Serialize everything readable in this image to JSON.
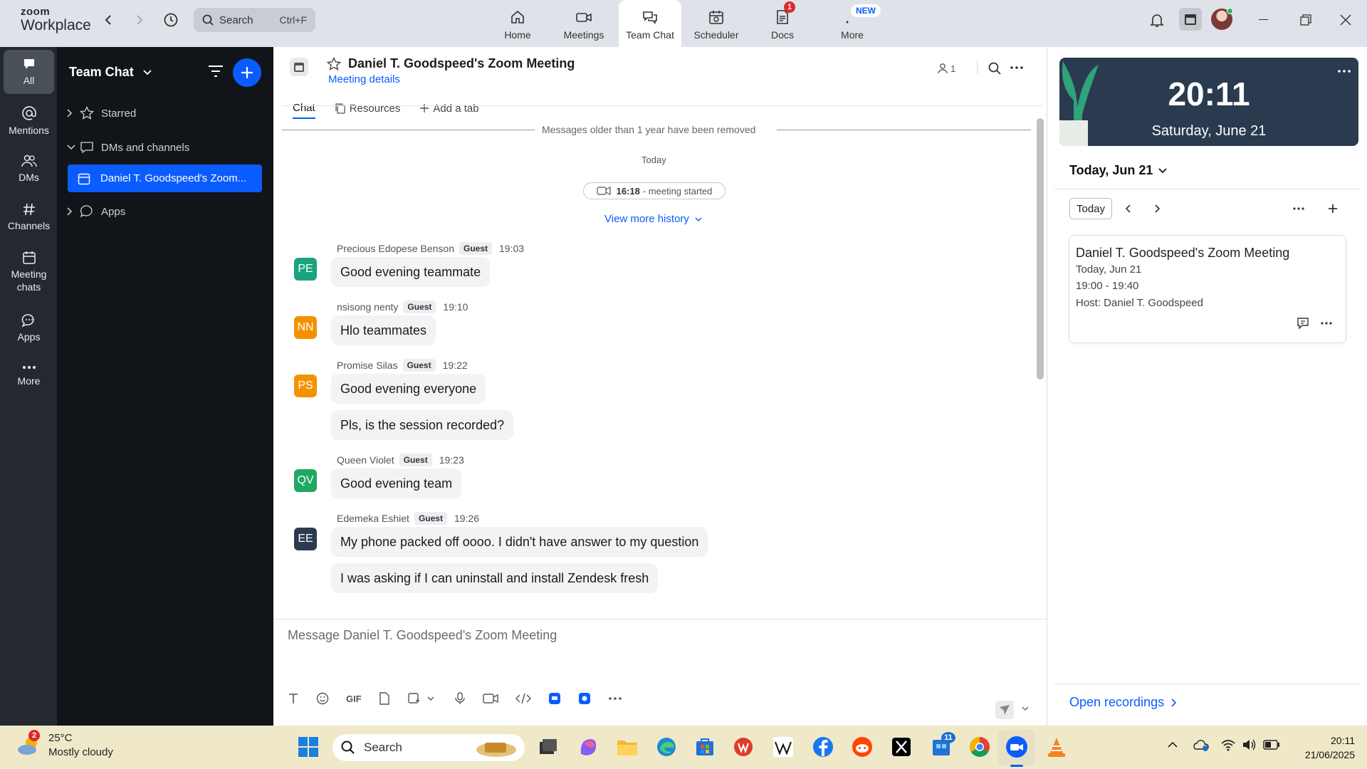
{
  "topbar": {
    "brand_line1": "zoom",
    "brand_line2": "Workplace",
    "search_placeholder": "Search",
    "search_shortcut": "Ctrl+F",
    "nav": [
      {
        "label": "Home",
        "icon": "home-icon"
      },
      {
        "label": "Meetings",
        "icon": "video-camera-icon"
      },
      {
        "label": "Team Chat",
        "icon": "chat-bubbles-icon",
        "active": true
      },
      {
        "label": "Scheduler",
        "icon": "calendar-clock-icon"
      },
      {
        "label": "Docs",
        "icon": "document-icon",
        "badge": "1"
      },
      {
        "label": "More",
        "icon": "more-dots-icon",
        "badge": "NEW"
      }
    ]
  },
  "rail": {
    "items": [
      {
        "label": "All",
        "icon": "chat-icon",
        "active": true
      },
      {
        "label": "Mentions",
        "icon": "at-icon"
      },
      {
        "label": "DMs",
        "icon": "people-icon"
      },
      {
        "label": "Channels",
        "icon": "hash-icon"
      },
      {
        "label": "Meeting chats",
        "icon": "calendar-icon"
      },
      {
        "label": "Apps",
        "icon": "apps-chat-icon"
      },
      {
        "label": "More",
        "icon": "ellipsis-icon"
      }
    ]
  },
  "sidebar": {
    "title": "Team Chat",
    "sections": {
      "starred": "Starred",
      "dms_channels": "DMs and channels",
      "apps": "Apps"
    },
    "active_item": "Daniel T. Goodspeed's Zoom..."
  },
  "chat": {
    "title": "Daniel T. Goodspeed's Zoom Meeting",
    "subtitle": "Meeting details",
    "member_count": "1",
    "tabs": [
      "Chat",
      "Resources",
      "Add a tab"
    ],
    "system_notice": "Messages older than 1 year have been removed",
    "day_label": "Today",
    "meeting_time": "16:18",
    "meeting_status": "- meeting started",
    "view_more": "View more history",
    "guest_label": "Guest",
    "messages": [
      {
        "sender": "Precious Edopese Benson",
        "initials": "PE",
        "time": "19:03",
        "color": "#1aa37e",
        "lines": [
          "Good evening teammate"
        ]
      },
      {
        "sender": "nsisong nenty",
        "initials": "NN",
        "time": "19:10",
        "color": "#f39200",
        "lines": [
          "Hlo teammates"
        ]
      },
      {
        "sender": "Promise Silas",
        "initials": "PS",
        "time": "19:22",
        "color": "#f39200",
        "lines": [
          "Good evening everyone",
          "Pls, is the session recorded?"
        ]
      },
      {
        "sender": "Queen Violet",
        "initials": "QV",
        "time": "19:23",
        "color": "#1fa862",
        "lines": [
          "Good evening team"
        ]
      },
      {
        "sender": "Edemeka Eshiet",
        "initials": "EE",
        "time": "19:26",
        "color": "#2b3a4d",
        "lines": [
          "My phone packed off oooo. I didn't have answer to my question",
          "I was asking if I can uninstall and install Zendesk fresh"
        ]
      }
    ],
    "composer_placeholder": "Message Daniel T. Goodspeed's Zoom Meeting",
    "toolbar_gif": "GIF"
  },
  "calendar": {
    "clock_time": "20:11",
    "clock_date": "Saturday, June 21",
    "header": "Today, Jun 21",
    "today_button": "Today",
    "event": {
      "title": "Daniel T. Goodspeed's Zoom Meeting",
      "date": "Today, Jun 21",
      "time": "19:00 - 19:40",
      "host": "Host: Daniel T. Goodspeed"
    },
    "open_recordings": "Open recordings"
  },
  "taskbar": {
    "weather_badge": "2",
    "temperature": "25°C",
    "condition": "Mostly cloudy",
    "search_placeholder": "Search",
    "store_badge": "11",
    "time": "20:11",
    "date": "21/06/2025"
  }
}
